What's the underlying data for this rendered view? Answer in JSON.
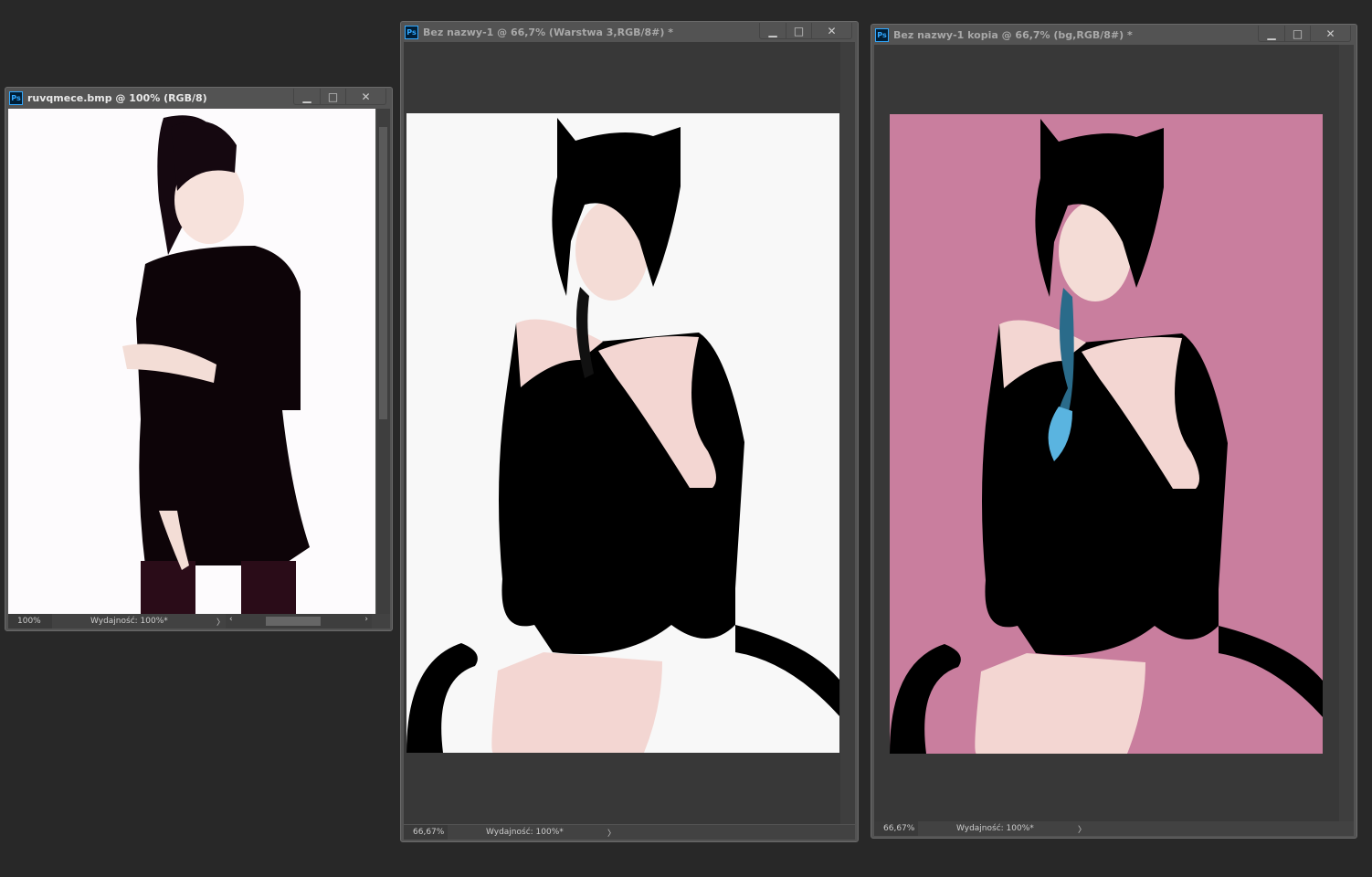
{
  "windows": [
    {
      "title": "ruvqmece.bmp @ 100% (RGB/8)",
      "zoom": "100%",
      "performance": "Wydajność: 100%*",
      "canvas_color": "#fdfbfd"
    },
    {
      "title": "Bez nazwy-1 @ 66,7% (Warstwa 3,RGB/8#) *",
      "zoom": "66,67%",
      "performance": "Wydajność: 100%*",
      "canvas_color": "#f8f8f8"
    },
    {
      "title": "Bez nazwy-1 kopia @ 66,7% (bg,RGB/8#) *",
      "zoom": "66,67%",
      "performance": "Wydajność: 100%*",
      "canvas_color": "#c97e9e"
    }
  ],
  "icons": {
    "app": "Ps",
    "minimize": "minimize-icon",
    "maximize": "maximize-icon",
    "close": "close-icon"
  },
  "labels": {
    "ps": "Ps",
    "min": "▁",
    "max": "□",
    "close": "✕",
    "arrow": "〉",
    "left": "‹",
    "right": "›"
  }
}
